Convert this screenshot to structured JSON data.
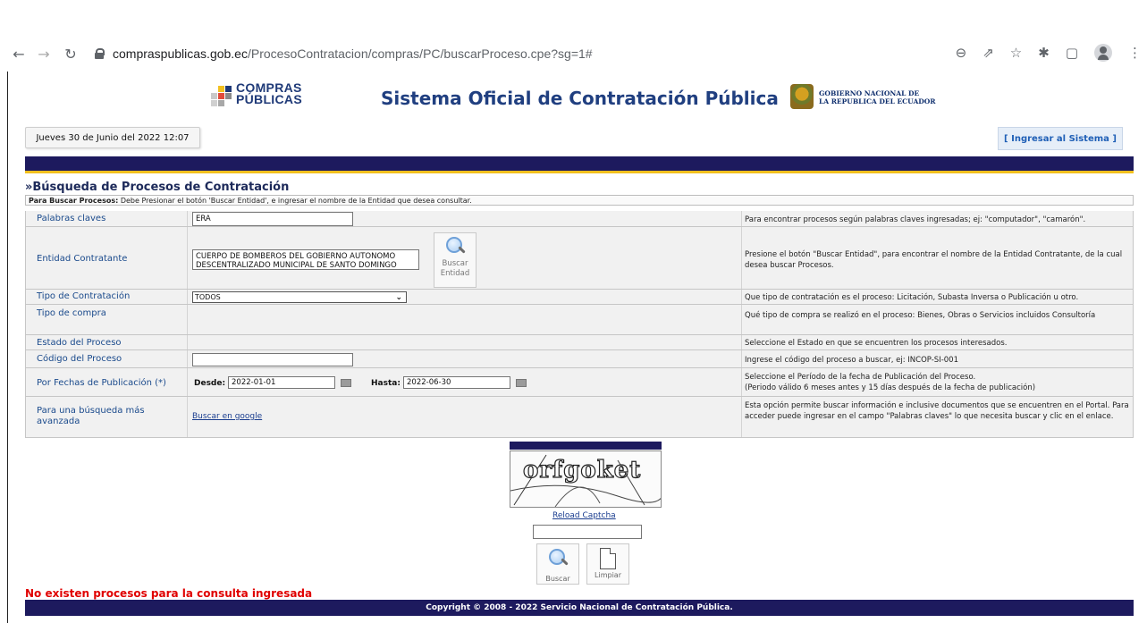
{
  "browser": {
    "url_host": "compraspublicas.gob.ec",
    "url_path": "/ProcesoContratacion/compras/PC/buscarProceso.cpe?sg=1#"
  },
  "header": {
    "logo_line1": "COMPRAS",
    "logo_line2": "PÚBLICAS",
    "title": "Sistema Oficial de Contratación Pública",
    "gov_line1": "GOBIERNO NACIONAL DE",
    "gov_line2": "LA REPUBLICA DEL ECUADOR",
    "date": "Jueves 30 de Junio del 2022 12:07",
    "login": "[ Ingresar al Sistema ]"
  },
  "search": {
    "section_title": "»Búsqueda de Procesos de Contratación",
    "instr_bold": "Para Buscar Procesos:",
    "instr_text": " Debe Presionar el botón 'Buscar Entidad', e ingresar el nombre de la Entidad que desea consultar.",
    "rows": {
      "keywords": {
        "label": "Palabras claves",
        "value": "ERA",
        "help": "Para encontrar procesos según palabras claves ingresadas; ej: \"computador\", \"camarón\"."
      },
      "entity": {
        "label": "Entidad Contratante",
        "value": "CUERPO DE BOMBEROS DEL GOBIERNO AUTONOMO DESCENTRALIZADO MUNICIPAL DE SANTO DOMINGO",
        "button_label1": "Buscar",
        "button_label2": "Entidad",
        "help": "Presione el botón \"Buscar Entidad\", para encontrar el nombre de la Entidad Contratante, de la cual desea buscar Procesos."
      },
      "contract_type": {
        "label": "Tipo de Contratación",
        "value": "TODOS",
        "help": "Que tipo de contratación es el proceso: Licitación, Subasta Inversa o Publicación u otro."
      },
      "purchase_type": {
        "label": "Tipo de compra",
        "help": "Qué tipo de compra se realizó en el proceso: Bienes, Obras o Servicios incluidos Consultoría"
      },
      "status": {
        "label": "Estado del Proceso",
        "help": "Seleccione el Estado en que se encuentren los procesos interesados."
      },
      "code": {
        "label": "Código del Proceso",
        "value": "",
        "help": "Ingrese el código del proceso a buscar, ej: INCOP-SI-001"
      },
      "dates": {
        "label": "Por Fechas de Publicación (*)",
        "from_label": "Desde:",
        "from_value": "2022-01-01",
        "to_label": "Hasta:",
        "to_value": "2022-06-30",
        "help1": "Seleccione el Período de la fecha de Publicación del Proceso.",
        "help2": "(Periodo válido 6 meses antes y 15 días después de la fecha de publicación)"
      },
      "advanced": {
        "label1": "Para una búsqueda más",
        "label2": "avanzada",
        "link": "Buscar en google",
        "help": "Esta opción permite buscar información e inclusive documentos que se encuentren en el Portal. Para acceder puede ingresar en el campo \"Palabras claves\" lo que necesita buscar y clic en el enlace."
      }
    }
  },
  "captcha": {
    "text": "orfgoket",
    "reload": "Reload Captcha",
    "value": ""
  },
  "actions": {
    "search": "Buscar",
    "clear": "Limpiar"
  },
  "result_message": "No existen procesos para la consulta ingresada",
  "footer": "Copyright © 2008 - 2022 Servicio Nacional de Contratación Pública.",
  "colors": {
    "navy": "#1d1a5e",
    "accent_yellow": "#f2c01f",
    "error_red": "#e00000",
    "link_blue": "#1a3d8f"
  }
}
